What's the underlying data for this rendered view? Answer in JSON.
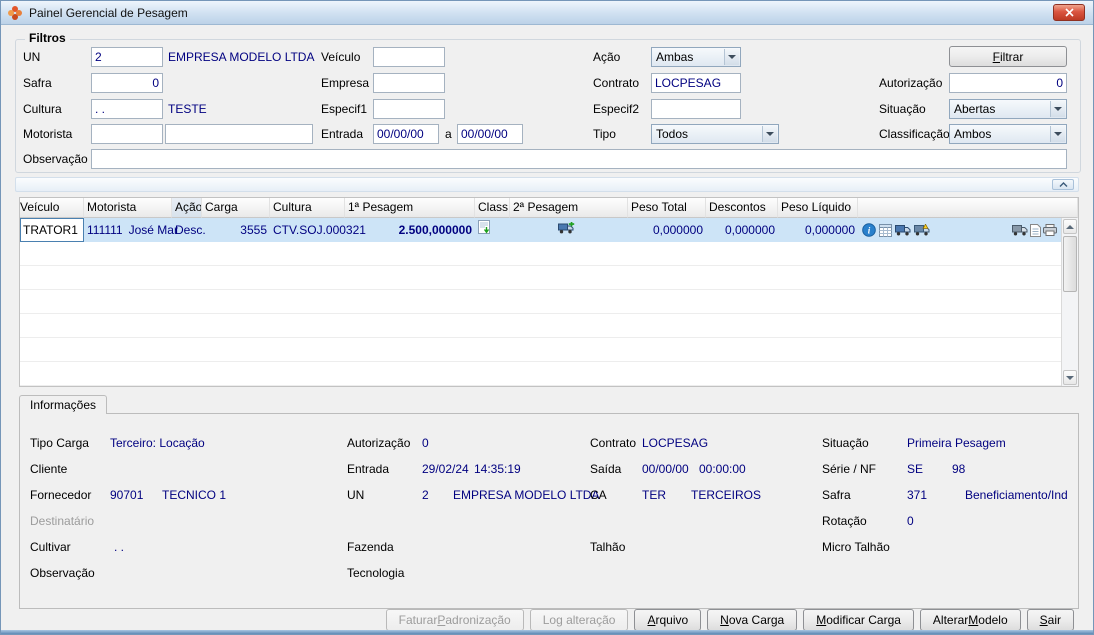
{
  "window": {
    "title": "Painel Gerencial de Pesagem"
  },
  "colors": {
    "accent_text": "#000080",
    "selected_row": "#cde4f7",
    "titlebar": "#bcd2e8",
    "close_button": "#bd3a24"
  },
  "icons": {
    "titlebar": "app-logo-icon",
    "close": "close-icon",
    "collapse": "chevron-up-icon",
    "grid_row": [
      "weighing-ticket-icon",
      "truck-add-icon",
      "info-icon",
      "details-grid-icon",
      "truck-blue-icon",
      "truck-warning-icon",
      "truck-gray-icon",
      "document-icon",
      "printer-icon"
    ]
  },
  "filters": {
    "group_label": "Filtros",
    "un": {
      "label": "UN",
      "value": "2",
      "desc": "EMPRESA MODELO LTDA"
    },
    "safra": {
      "label": "Safra",
      "value": "0"
    },
    "cultura": {
      "label": "Cultura",
      "value": ". .",
      "desc": "TESTE"
    },
    "motorista": {
      "label": "Motorista",
      "code": "",
      "name": ""
    },
    "observacao": {
      "label": "Observação",
      "value": ""
    },
    "veiculo": {
      "label": "Veículo",
      "value": ""
    },
    "empresa": {
      "label": "Empresa",
      "value": ""
    },
    "especif1": {
      "label": "Especif1",
      "value": ""
    },
    "entrada": {
      "label": "Entrada",
      "from": "00/00/00",
      "sep": "a",
      "to": "00/00/00"
    },
    "acao": {
      "label": "Ação",
      "value": "Ambas"
    },
    "contrato": {
      "label": "Contrato",
      "value": "LOCPESAG"
    },
    "especif2": {
      "label": "Especif2",
      "value": ""
    },
    "tipo": {
      "label": "Tipo",
      "value": "Todos"
    },
    "autorizacao": {
      "label": "Autorização",
      "value": "0"
    },
    "situacao": {
      "label": "Situação",
      "value": "Abertas"
    },
    "classificacao": {
      "label": "Classificação",
      "value": "Ambos"
    },
    "filtrar_button": {
      "label": "Filtrar",
      "hotkey": "F"
    }
  },
  "grid": {
    "columns": [
      "Veículo",
      "Motorista",
      "Ação",
      "Carga",
      "Cultura",
      "1ª Pesagem",
      "Class.",
      "2ª Pesagem",
      "Peso Total",
      "Descontos",
      "Peso Líquido"
    ],
    "rows": [
      {
        "veiculo": "TRATOR1",
        "motorista_code": "111111",
        "motorista_name": "José Mar",
        "acao": "Desc.",
        "carga": "3555",
        "cultura": "CTV.SOJ.000321",
        "pesagem1": "2.500,000000",
        "peso_total": "0,000000",
        "descontos": "0,000000",
        "peso_liquido": "0,000000"
      }
    ]
  },
  "info": {
    "tab_label": "Informações",
    "tipo_carga": {
      "label": "Tipo Carga",
      "value": "Terceiro: Locação"
    },
    "cliente": {
      "label": "Cliente",
      "value": ""
    },
    "fornecedor": {
      "label": "Fornecedor",
      "code": "90701",
      "name": "TECNICO 1"
    },
    "destinatario": {
      "label": "Destinatário",
      "value": ""
    },
    "cultivar": {
      "label": "Cultivar",
      "value": ". ."
    },
    "observacao": {
      "label": "Observação",
      "value": ""
    },
    "autorizacao": {
      "label": "Autorização",
      "value": "0"
    },
    "entrada": {
      "label": "Entrada",
      "date": "29/02/24",
      "time": "14:35:19"
    },
    "un": {
      "label": "UN",
      "value": "2",
      "desc": "EMPRESA MODELO LTDA"
    },
    "fazenda": {
      "label": "Fazenda",
      "value": ""
    },
    "tecnologia": {
      "label": "Tecnologia",
      "value": ""
    },
    "contrato": {
      "label": "Contrato",
      "value": "LOCPESAG"
    },
    "saida": {
      "label": "Saída",
      "date": "00/00/00",
      "time": "00:00:00"
    },
    "ca": {
      "label": "CA",
      "code": "TER",
      "name": "TERCEIROS"
    },
    "talhao": {
      "label": "Talhão",
      "value": ""
    },
    "situacao": {
      "label": "Situação",
      "value": "Primeira Pesagem"
    },
    "serie_nf": {
      "label": "Série / NF",
      "serie": "SE",
      "nf": "98"
    },
    "safra": {
      "label": "Safra",
      "value": "371",
      "desc": "Beneficiamento/Ind"
    },
    "rotacao": {
      "label": "Rotação",
      "value": "0"
    },
    "micro_talhao": {
      "label": "Micro Talhão",
      "value": ""
    }
  },
  "footer": {
    "buttons": [
      {
        "label": "Faturar Padronização",
        "hotkey": "P",
        "disabled": true
      },
      {
        "label": "Log alteração",
        "disabled": true
      },
      {
        "label": "Arquivo",
        "hotkey": "A",
        "disabled": false
      },
      {
        "label": "Nova Carga",
        "hotkey": "N",
        "disabled": false
      },
      {
        "label": "Modificar Carga",
        "hotkey": "M",
        "disabled": false
      },
      {
        "label": "Alterar Modelo",
        "hotkey": "M",
        "disabled": false
      },
      {
        "label": "Sair",
        "hotkey": "S",
        "disabled": false
      }
    ]
  }
}
